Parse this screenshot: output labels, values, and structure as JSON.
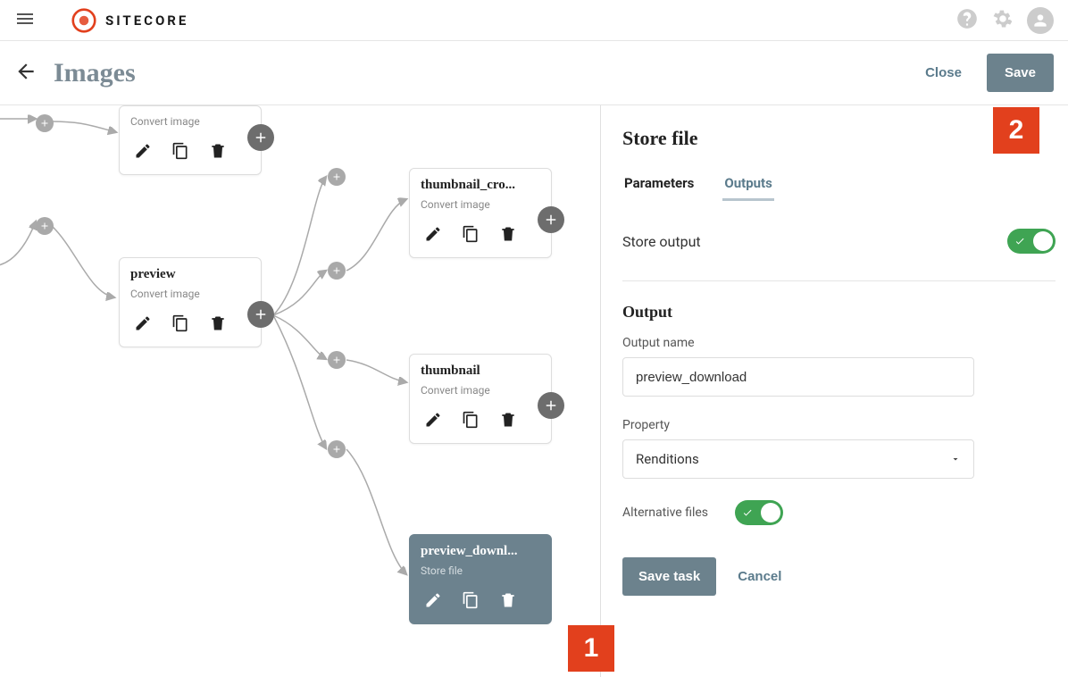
{
  "brand": "SITECORE",
  "page_title": "Images",
  "header_actions": {
    "close": "Close",
    "save": "Save"
  },
  "nodes": {
    "n0": {
      "title": "",
      "subtitle": "Convert image"
    },
    "n1": {
      "title": "preview",
      "subtitle": "Convert image"
    },
    "n2": {
      "title": "thumbnail_cro...",
      "subtitle": "Convert image"
    },
    "n3": {
      "title": "thumbnail",
      "subtitle": "Convert image"
    },
    "n4": {
      "title": "preview_downl...",
      "subtitle": "Store file"
    }
  },
  "panel": {
    "title": "Store file",
    "tabs": {
      "parameters": "Parameters",
      "outputs": "Outputs"
    },
    "store_output_label": "Store output",
    "output_section": "Output",
    "output_name_label": "Output name",
    "output_name_value": "preview_download",
    "property_label": "Property",
    "property_value": "Renditions",
    "alt_files_label": "Alternative files",
    "save_task": "Save task",
    "cancel": "Cancel"
  },
  "callouts": {
    "one": "1",
    "two": "2"
  }
}
